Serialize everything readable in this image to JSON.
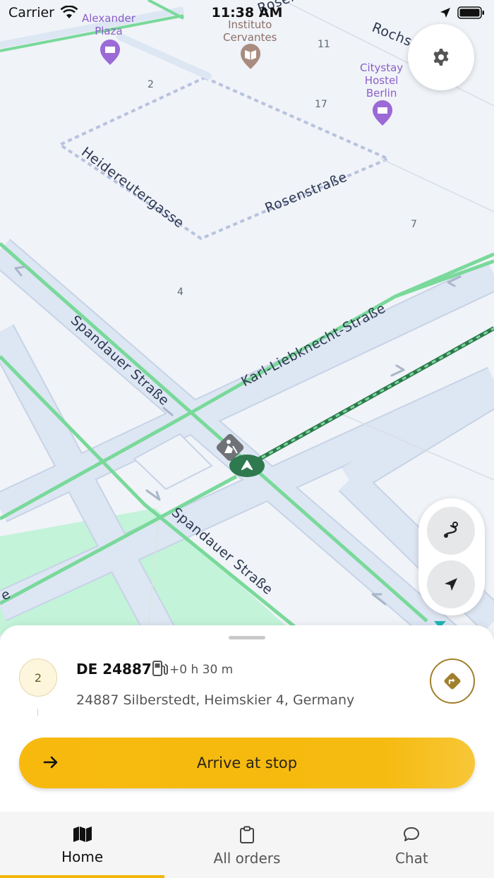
{
  "status_bar": {
    "carrier": "Carrier",
    "time": "11:38 AM"
  },
  "map": {
    "poi": [
      {
        "name": "Alexander Plaza",
        "line1": "Alexander",
        "line2": "Plaza",
        "icon": "hotel-icon",
        "color": "#9b6ad6"
      },
      {
        "name": "Instituto Cervantes",
        "line1": "Instituto",
        "line2": "Cervantes",
        "icon": "book-icon",
        "color": "#a98b80"
      },
      {
        "name": "Citystay Hostel Berlin",
        "line1": "Citystay",
        "line2": "Hostel",
        "line3": "Berlin",
        "icon": "hotel-icon",
        "color": "#9b6ad6"
      }
    ],
    "streets": {
      "heidereutergasse": "Heidereutergasse",
      "rosenstrasse": "Rosenstraße",
      "spandauer_1": "Spandauer Straße",
      "spandauer_2": "Spandauer Straße",
      "karl_liebknecht": "Karl-Liebknecht-Straße",
      "rochstrasse": "Rochs",
      "top_fragment": "Rosen",
      "left_fragment": "e"
    },
    "house_numbers": {
      "n2": "2",
      "n11": "11",
      "n17": "17",
      "n7": "7",
      "n4": "4"
    },
    "colors": {
      "road": "#dde6f3",
      "route_green": "#79d99a",
      "route_dark": "#2e7a4e",
      "park": "#c3f3d9",
      "vehicle": "#2e7a4e"
    }
  },
  "controls": {
    "settings_icon": "gear-icon",
    "route_icon": "route-icon",
    "locate_icon": "navigation-arrow-icon"
  },
  "sheet": {
    "stop_number": "2",
    "stop_code": "DE 24887",
    "eta": "+0 h 30 m",
    "address": "24887 Silberstedt, Heimskier 4, Germany",
    "arrive_label": "Arrive at stop",
    "accent": "#f6b90c"
  },
  "tabs": [
    {
      "label": "Home",
      "icon": "map-icon",
      "active": true
    },
    {
      "label": "All orders",
      "icon": "clipboard-icon",
      "active": false
    },
    {
      "label": "Chat",
      "icon": "chat-bubble-icon",
      "active": false
    }
  ]
}
